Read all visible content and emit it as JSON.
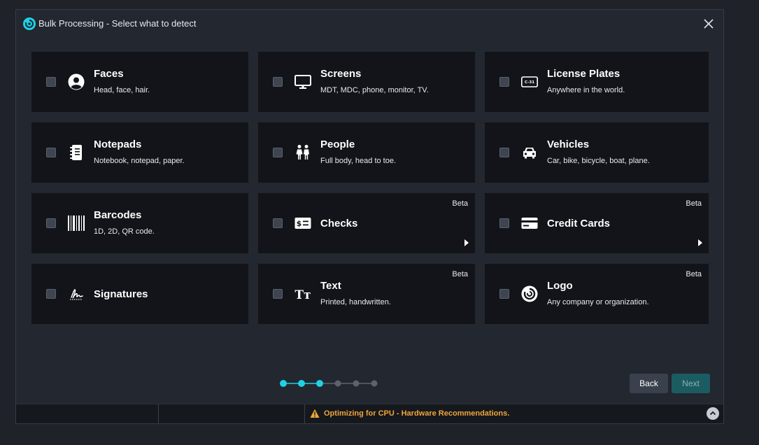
{
  "window": {
    "title": "Bulk Processing - Select what to detect"
  },
  "cards": [
    {
      "title": "Faces",
      "subtitle": "Head, face, hair.",
      "icon": "face-icon"
    },
    {
      "title": "Screens",
      "subtitle": "MDT, MDC, phone, monitor, TV.",
      "icon": "monitor-icon"
    },
    {
      "title": "License Plates",
      "subtitle": "Anywhere in the world.",
      "icon": "license-plate-icon",
      "plate_text": "C-31"
    },
    {
      "title": "Notepads",
      "subtitle": "Notebook, notepad, paper.",
      "icon": "notepad-icon"
    },
    {
      "title": "People",
      "subtitle": "Full body, head to toe.",
      "icon": "people-icon"
    },
    {
      "title": "Vehicles",
      "subtitle": "Car, bike, bicycle, boat, plane.",
      "icon": "car-icon"
    },
    {
      "title": "Barcodes",
      "subtitle": "1D, 2D, QR code.",
      "icon": "barcode-icon"
    },
    {
      "title": "Checks",
      "badge": "Beta",
      "icon": "check-icon"
    },
    {
      "title": "Credit Cards",
      "badge": "Beta",
      "icon": "credit-card-icon"
    },
    {
      "title": "Signatures",
      "icon": "signature-icon"
    },
    {
      "title": "Text",
      "subtitle": "Printed, handwritten.",
      "badge": "Beta",
      "icon": "text-icon",
      "glyph": "Tт"
    },
    {
      "title": "Logo",
      "subtitle": "Any company or organization.",
      "badge": "Beta",
      "icon": "logo-icon"
    }
  ],
  "stepper": {
    "total": 6,
    "current": 3
  },
  "buttons": {
    "back": "Back",
    "next": "Next"
  },
  "status": {
    "message": "Optimizing for CPU - Hardware Recommendations."
  },
  "colors": {
    "accent": "#1fd1e6",
    "warning": "#f0a53a",
    "card_bg": "#121419",
    "dialog_bg": "#23272f"
  }
}
